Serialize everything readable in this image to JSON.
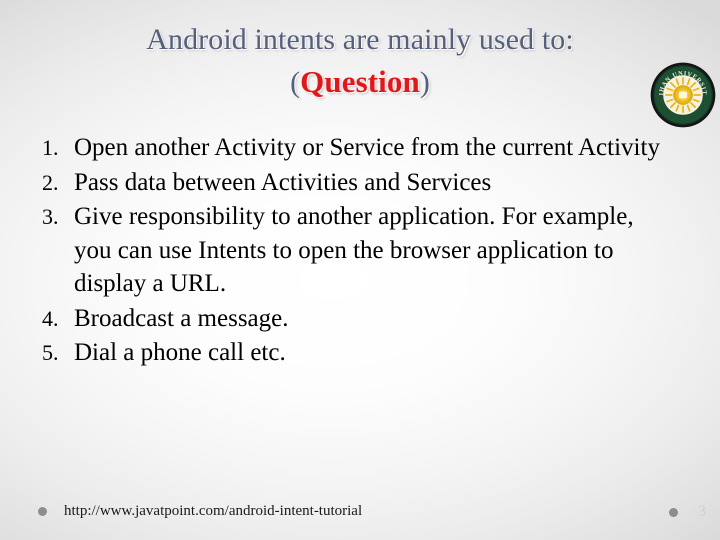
{
  "slide": {
    "title_line_1": "Android intents are mainly used to:",
    "title_line_2_open_paren": "(",
    "title_line_2_word": "Question",
    "title_line_2_close_paren": ")",
    "title_color": "#555f7c",
    "question_color": "#e1181a",
    "background_edge_color": "#dadada",
    "background_center_color": "#ffffff"
  },
  "logo": {
    "name": "cihan-university-seal",
    "outer_ring_text": "CIHAN UNIVERSITY",
    "ring_color": "#1e5134",
    "outer_edge_color": "#1c1c1c",
    "center_emblem_color": "#e8b417",
    "inner_disc_color": "#f7f2e0"
  },
  "list": {
    "items": [
      {
        "number": "1.",
        "text": "Open another Activity or Service from the current Activity",
        "justified": true
      },
      {
        "number": "2.",
        "text": "Pass data between Activities and Services",
        "justified": false
      },
      {
        "number": "3.",
        "text": "Give responsibility to another application. For example, you can use Intents to open the browser application to display a URL.",
        "justified": false
      },
      {
        "number": "4.",
        "text": "Broadcast a message.",
        "justified": false
      },
      {
        "number": "5.",
        "text": "Dial a phone call etc.",
        "justified": false
      }
    ]
  },
  "footer": {
    "url": "http://www.javatpoint.com/android-intent-tutorial",
    "page_number": "3",
    "bullet_color": "#8d8d8d",
    "page_number_color": "#cfcfcf"
  }
}
